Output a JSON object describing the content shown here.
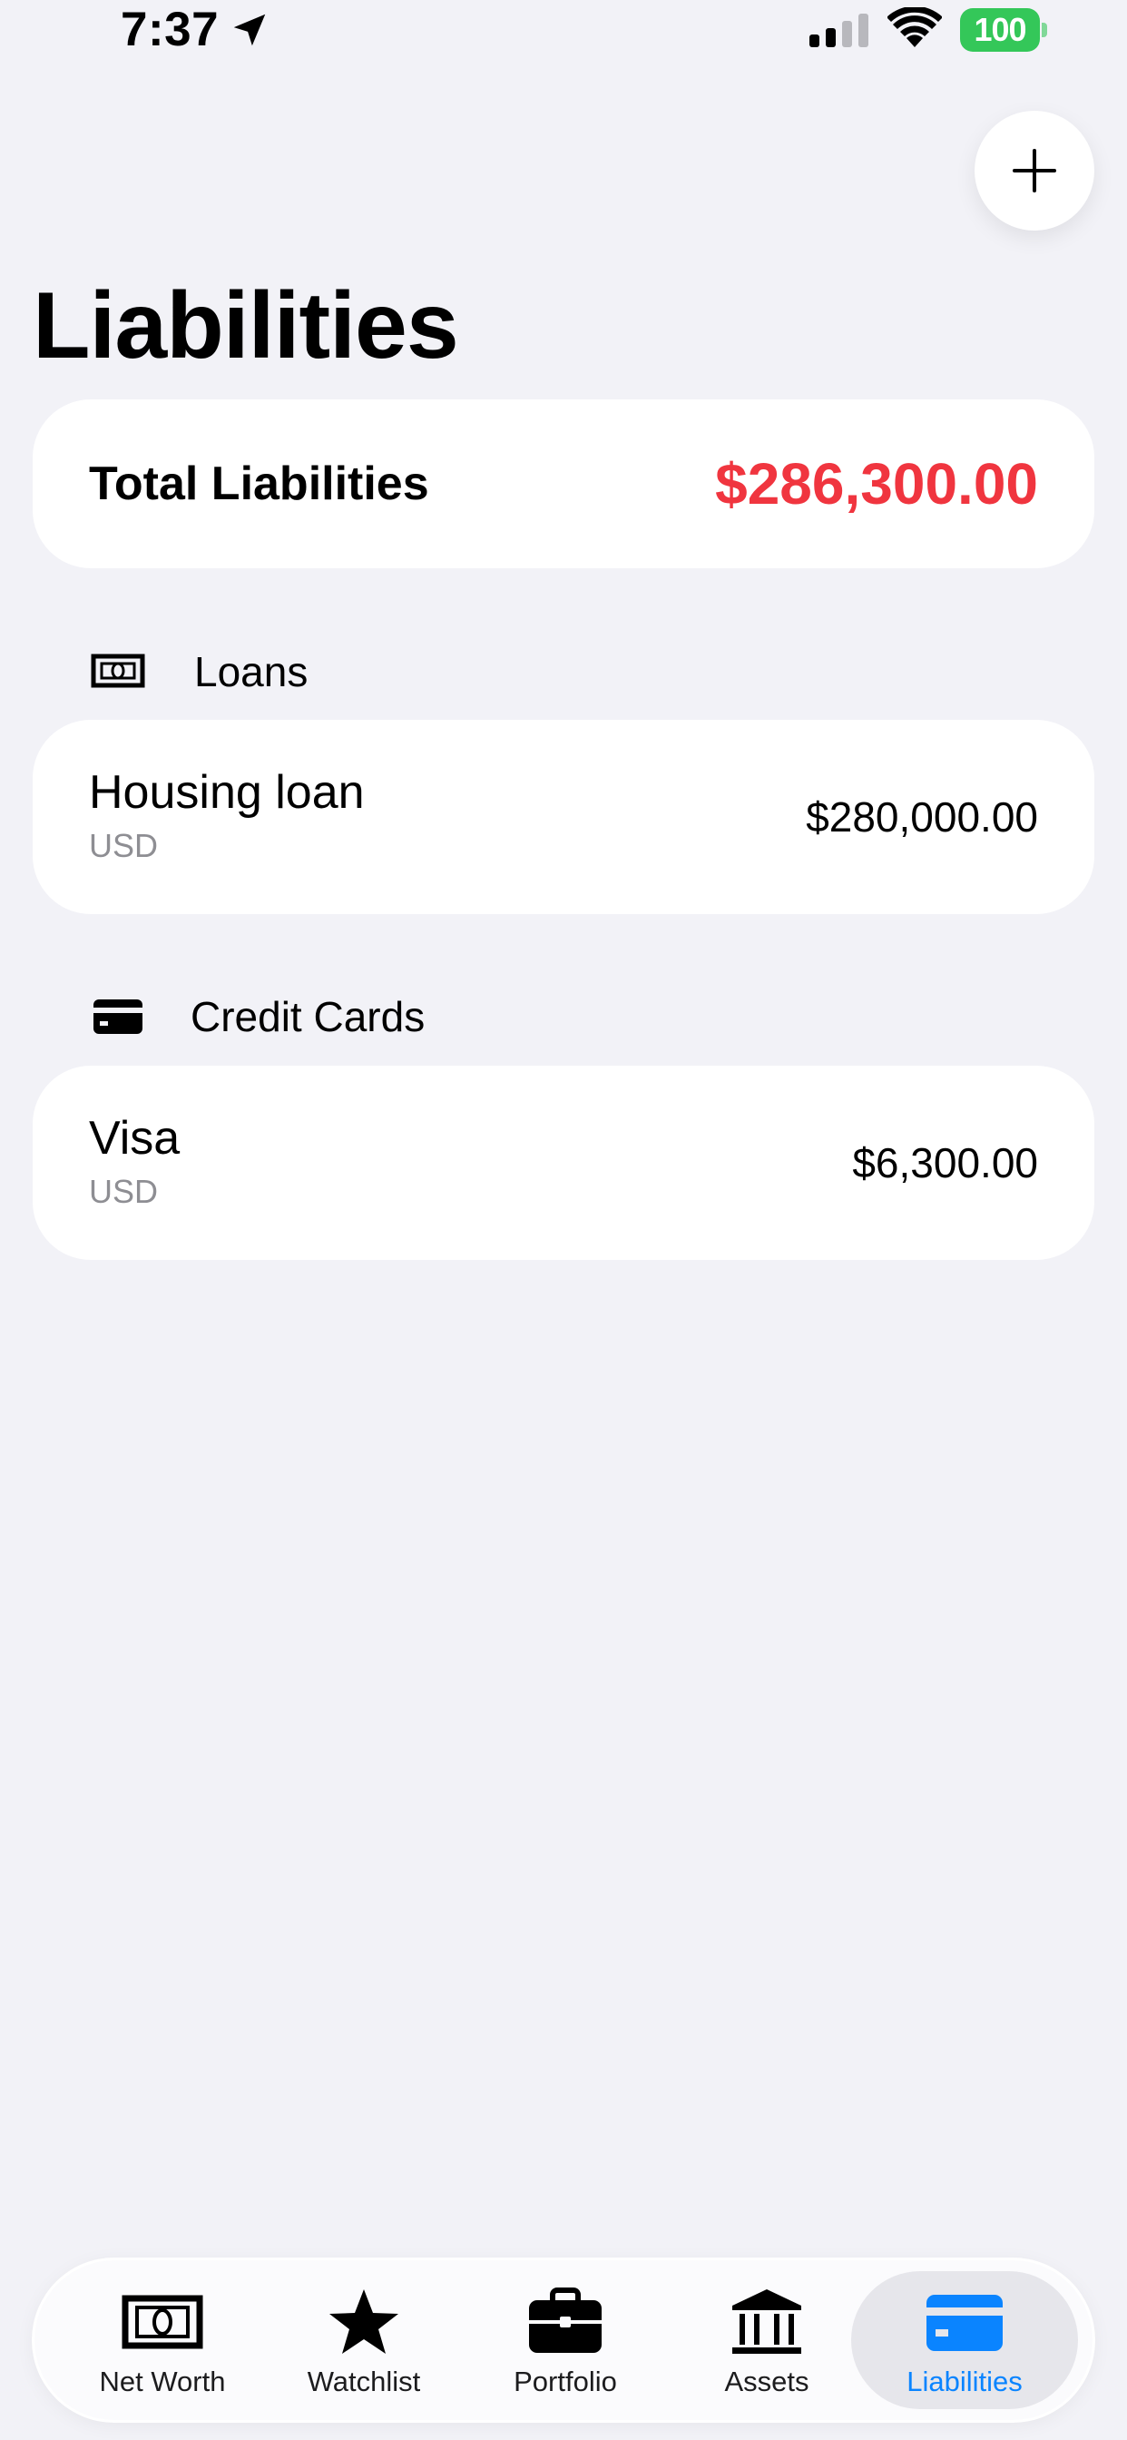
{
  "status_bar": {
    "time": "7:37",
    "battery": "100",
    "battery_color": "#34c759"
  },
  "header": {
    "add_button_icon": "plus-icon",
    "title": "Liabilities"
  },
  "summary": {
    "label": "Total Liabilities",
    "value": "$286,300.00",
    "value_color": "#f0353f"
  },
  "sections": [
    {
      "icon": "banknote-icon",
      "label": "Loans",
      "items": [
        {
          "name": "Housing loan",
          "currency": "USD",
          "value": "$280,000.00"
        }
      ]
    },
    {
      "icon": "credit-card-icon",
      "label": "Credit Cards",
      "items": [
        {
          "name": "Visa",
          "currency": "USD",
          "value": "$6,300.00"
        }
      ]
    }
  ],
  "tab_bar": {
    "active_color": "#0a84ff",
    "tabs": [
      {
        "label": "Net Worth",
        "icon": "banknote-icon",
        "active": false
      },
      {
        "label": "Watchlist",
        "icon": "star-icon",
        "active": false
      },
      {
        "label": "Portfolio",
        "icon": "briefcase-icon",
        "active": false
      },
      {
        "label": "Assets",
        "icon": "bank-icon",
        "active": false
      },
      {
        "label": "Liabilities",
        "icon": "credit-card-icon",
        "active": true
      }
    ]
  }
}
